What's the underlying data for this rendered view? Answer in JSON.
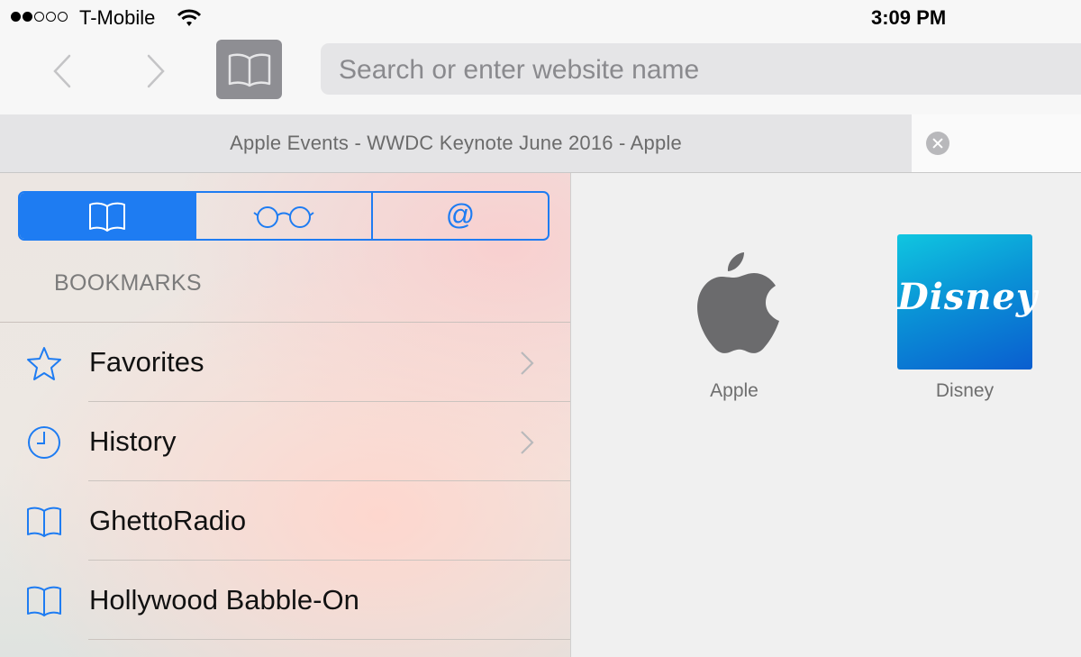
{
  "status_bar": {
    "signal_bars_filled": 2,
    "signal_bars_total": 5,
    "carrier": "T-Mobile",
    "time": "3:09 PM"
  },
  "toolbar": {
    "search_placeholder": "Search or enter website name",
    "search_value": ""
  },
  "tab": {
    "title": "Apple Events - WWDC Keynote June 2016 - Apple"
  },
  "sidebar": {
    "segments": [
      {
        "icon": "book-icon",
        "active": true
      },
      {
        "icon": "glasses-icon",
        "active": false
      },
      {
        "label": "@",
        "icon": "at-icon",
        "active": false
      }
    ],
    "section_title": "BOOKMARKS",
    "items": [
      {
        "label": "Favorites",
        "icon": "star-icon",
        "has_chevron": true
      },
      {
        "label": "History",
        "icon": "clock-icon",
        "has_chevron": true
      },
      {
        "label": "GhettoRadio",
        "icon": "book-icon",
        "has_chevron": false
      },
      {
        "label": "Hollywood Babble-On",
        "icon": "book-icon",
        "has_chevron": false
      }
    ]
  },
  "favorites": [
    {
      "label": "Apple",
      "icon": "apple-logo-icon"
    },
    {
      "label": "Disney",
      "icon": "disney-logo-icon",
      "logo_text": "Disney",
      "tile_color": "#0a93d6"
    }
  ],
  "colors": {
    "accent": "#1e7cf2",
    "label_gray": "#6e6e6e"
  }
}
